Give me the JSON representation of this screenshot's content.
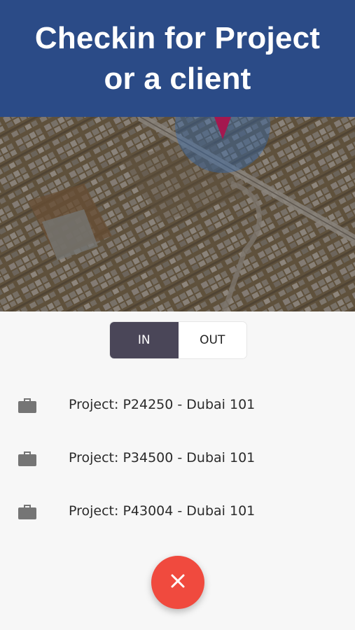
{
  "banner": {
    "title_line1": "Checkin for Project",
    "title_line2": "or a client"
  },
  "checkin_toggle": {
    "in_label": "IN",
    "out_label": "OUT",
    "selected": "IN"
  },
  "projects": [
    {
      "label": "Project: P24250 - Dubai 101",
      "icon": "briefcase-icon"
    },
    {
      "label": "Project: P34500 - Dubai 101",
      "icon": "briefcase-icon"
    },
    {
      "label": "Project: P43004 - Dubai 101",
      "icon": "briefcase-icon"
    }
  ],
  "fab": {
    "icon": "close-icon"
  },
  "colors": {
    "banner": "#2b4b87",
    "toggle_active": "#4a4658",
    "fab": "#f04a3e",
    "map_pin": "#c2185b",
    "location_circle": "#3a78c8"
  }
}
